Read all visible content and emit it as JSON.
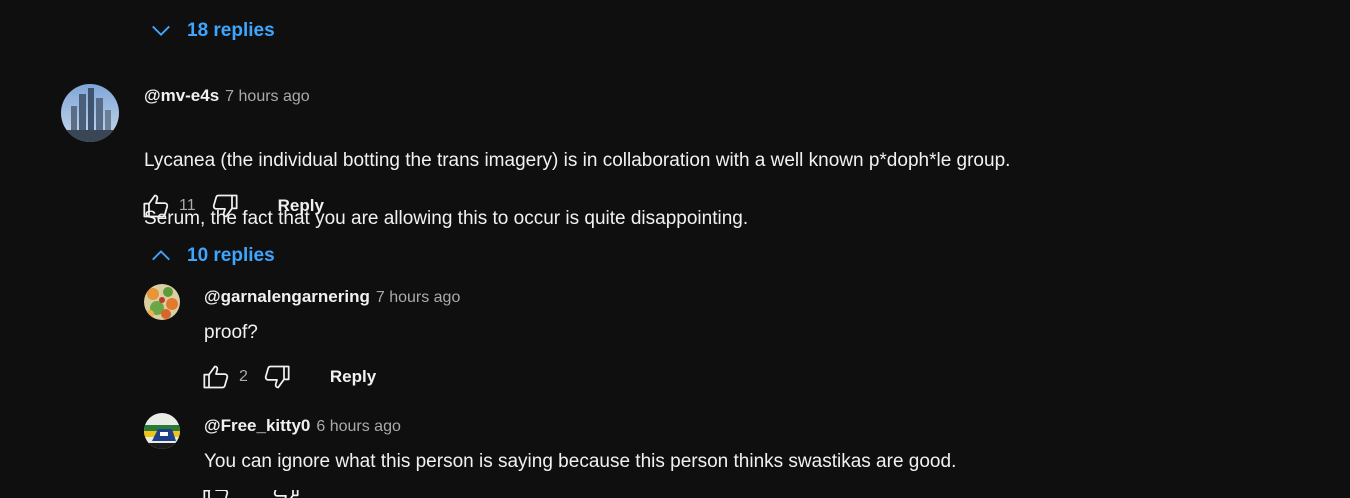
{
  "top_replies_toggle": {
    "label": "18 replies",
    "icon": "chevron-down-icon"
  },
  "comment": {
    "author": "@mv-e4s",
    "time": "7 hours ago",
    "text_line1": "Lycanea (the individual botting the trans imagery) is in collaboration with a well known p*doph*le group.",
    "text_line2": "Serum, the fact that you are allowing this to occur is quite disappointing.",
    "likes": "11",
    "reply_label": "Reply"
  },
  "replies_toggle": {
    "label": "10 replies",
    "icon": "chevron-up-icon"
  },
  "replies": [
    {
      "author": "@garnalengarnering",
      "time": "7 hours ago",
      "text": "proof?",
      "likes": "2",
      "reply_label": "Reply"
    },
    {
      "author": "@Free_kitty0",
      "time": "6 hours ago",
      "text": "You can ignore what this person is saying because this person thinks swastikas are good."
    }
  ],
  "colors": {
    "background": "#0f0f0f",
    "link_blue": "#3ea6ff",
    "text": "#f1f1f1",
    "secondary_text": "#aaaaaa"
  }
}
